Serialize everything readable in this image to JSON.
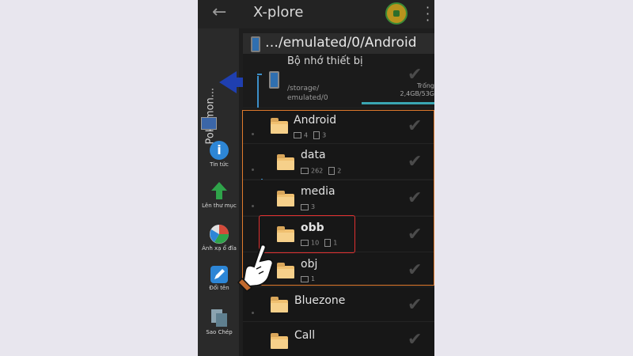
{
  "app": {
    "title": "X-plore",
    "back_icon": "arrow-left-icon",
    "menu_icon": "more-vertical-icon"
  },
  "sidebar": {
    "vertical_label": "Pokemon...",
    "tools": [
      {
        "label": "Tin tức",
        "icon": "info-icon",
        "color": "#2d86d6"
      },
      {
        "label": "Lên thư mục",
        "icon": "arrow-up-icon",
        "color": "#2fa34a"
      },
      {
        "label": "Ánh xạ ổ đĩa",
        "icon": "pie-chart-icon",
        "color": "#d44a3a"
      },
      {
        "label": "Đổi tên",
        "icon": "pencil-icon",
        "color": "#2d86d6"
      },
      {
        "label": "Sao Chép",
        "icon": "copy-icon",
        "color": "#6b8a9a"
      }
    ]
  },
  "path": {
    "text": "…/emulated/0/Android"
  },
  "storage": {
    "name": "Bộ nhớ thiết bị",
    "path": "/storage/ emulated/0",
    "free_label": "Trống",
    "size_text": "2,4GB/53G"
  },
  "folders": [
    {
      "name": "Android",
      "folders": "4",
      "files": "3"
    },
    {
      "name": "data",
      "folders": "262",
      "files": "2"
    },
    {
      "name": "media",
      "folders": "3",
      "files": ""
    },
    {
      "name": "obb",
      "folders": "10",
      "files": "1"
    },
    {
      "name": "obj",
      "folders": "1",
      "files": ""
    },
    {
      "name": "Bluezone",
      "folders": "",
      "files": ""
    },
    {
      "name": "Call",
      "folders": "",
      "files": ""
    }
  ],
  "colors": {
    "highlight_outer": "#e07a2c",
    "highlight_inner": "#e03030",
    "tree_line": "#3c8fc9"
  }
}
